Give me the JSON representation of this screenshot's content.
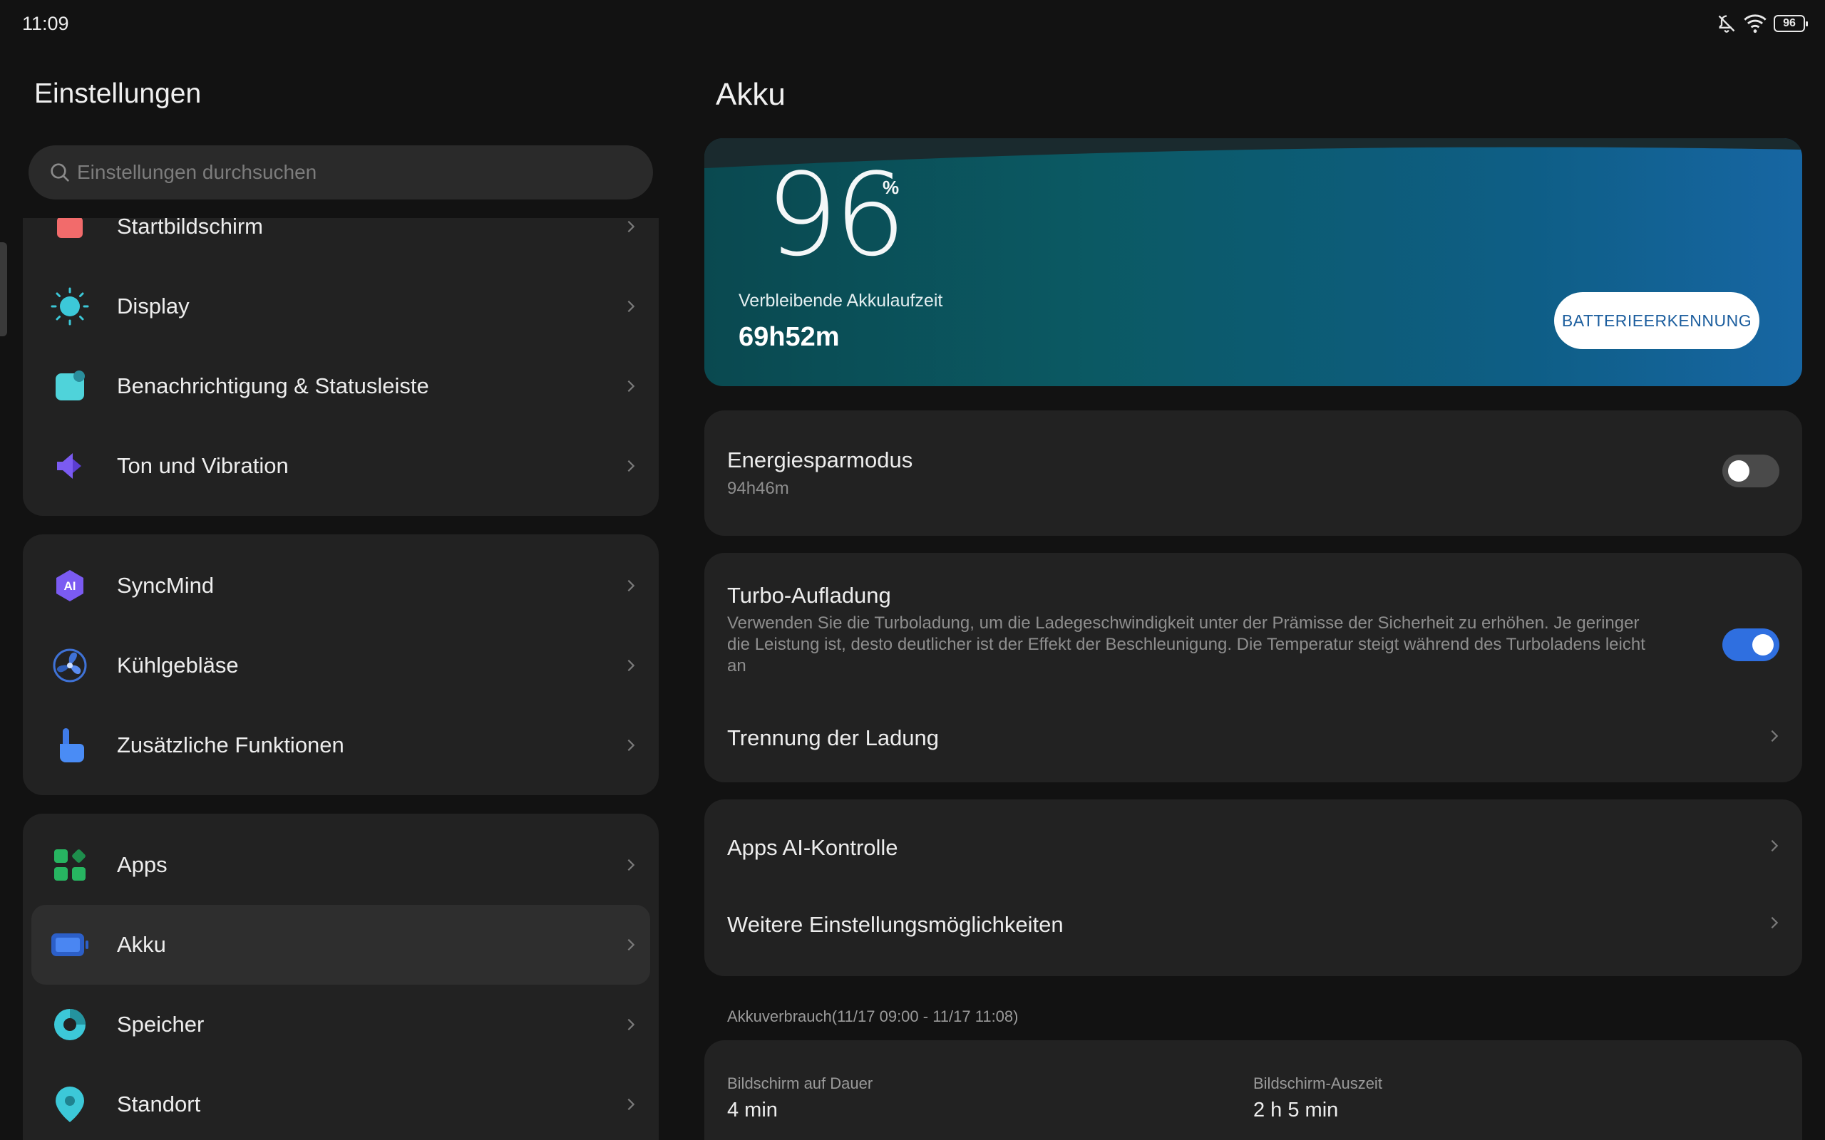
{
  "status_bar": {
    "time": "11:09",
    "battery_level": "96",
    "icons": [
      "notifications-off-icon",
      "wifi-icon",
      "battery-icon"
    ]
  },
  "sidebar": {
    "title": "Einstellungen",
    "search_placeholder": "Einstellungen durchsuchen",
    "groups": [
      {
        "items": [
          {
            "label": "Startbildschirm",
            "icon": "home-screen-icon"
          },
          {
            "label": "Display",
            "icon": "brightness-icon"
          },
          {
            "label": "Benachrichtigung & Statusleiste",
            "icon": "notification-icon"
          },
          {
            "label": "Ton und Vibration",
            "icon": "speaker-icon"
          }
        ]
      },
      {
        "items": [
          {
            "label": "SyncMind",
            "icon": "ai-icon"
          },
          {
            "label": "Kühlgebläse",
            "icon": "fan-icon"
          },
          {
            "label": "Zusätzliche Funktionen",
            "icon": "hand-pointer-icon"
          }
        ]
      },
      {
        "items": [
          {
            "label": "Apps",
            "icon": "apps-grid-icon"
          },
          {
            "label": "Akku",
            "icon": "battery-icon",
            "selected": true
          },
          {
            "label": "Speicher",
            "icon": "storage-pie-icon"
          },
          {
            "label": "Standort",
            "icon": "location-pin-icon"
          }
        ]
      }
    ]
  },
  "main": {
    "title": "Akku",
    "hero": {
      "percent": "96",
      "percent_sign": "%",
      "remaining_label": "Verbleibende Akkulaufzeit",
      "remaining_time": "69h52m",
      "button_label": "BATTERIEERKENNUNG"
    },
    "power_saving": {
      "title": "Energiesparmodus",
      "subtitle": "94h46m",
      "enabled": false
    },
    "turbo": {
      "title": "Turbo-Aufladung",
      "description": "Verwenden Sie die Turboladung, um die Ladegeschwindigkeit unter der Prämisse der Sicherheit zu erhöhen. Je geringer die Leistung ist, desto deutlicher ist der Effekt der Beschleunigung. Die Temperatur steigt während des Turboladens leicht an",
      "enabled": true
    },
    "charge_separation": {
      "title": "Trennung der Ladung"
    },
    "apps_ai": {
      "title": "Apps AI-Kontrolle"
    },
    "more_settings": {
      "title": "Weitere Einstellungsmöglichkeiten"
    },
    "usage": {
      "label": "Akkuverbrauch(11/17 09:00 - 11/17 11:08)",
      "screen_on_label": "Bildschirm auf Dauer",
      "screen_on_value": "4 min",
      "screen_off_label": "Bildschirm-Auszeit",
      "screen_off_value": "2 h 5 min"
    }
  },
  "colors": {
    "background": "#121212",
    "card": "#222222",
    "accent": "#2F6FE0",
    "hero_start": "#0A4950",
    "hero_end": "#1766A3"
  }
}
